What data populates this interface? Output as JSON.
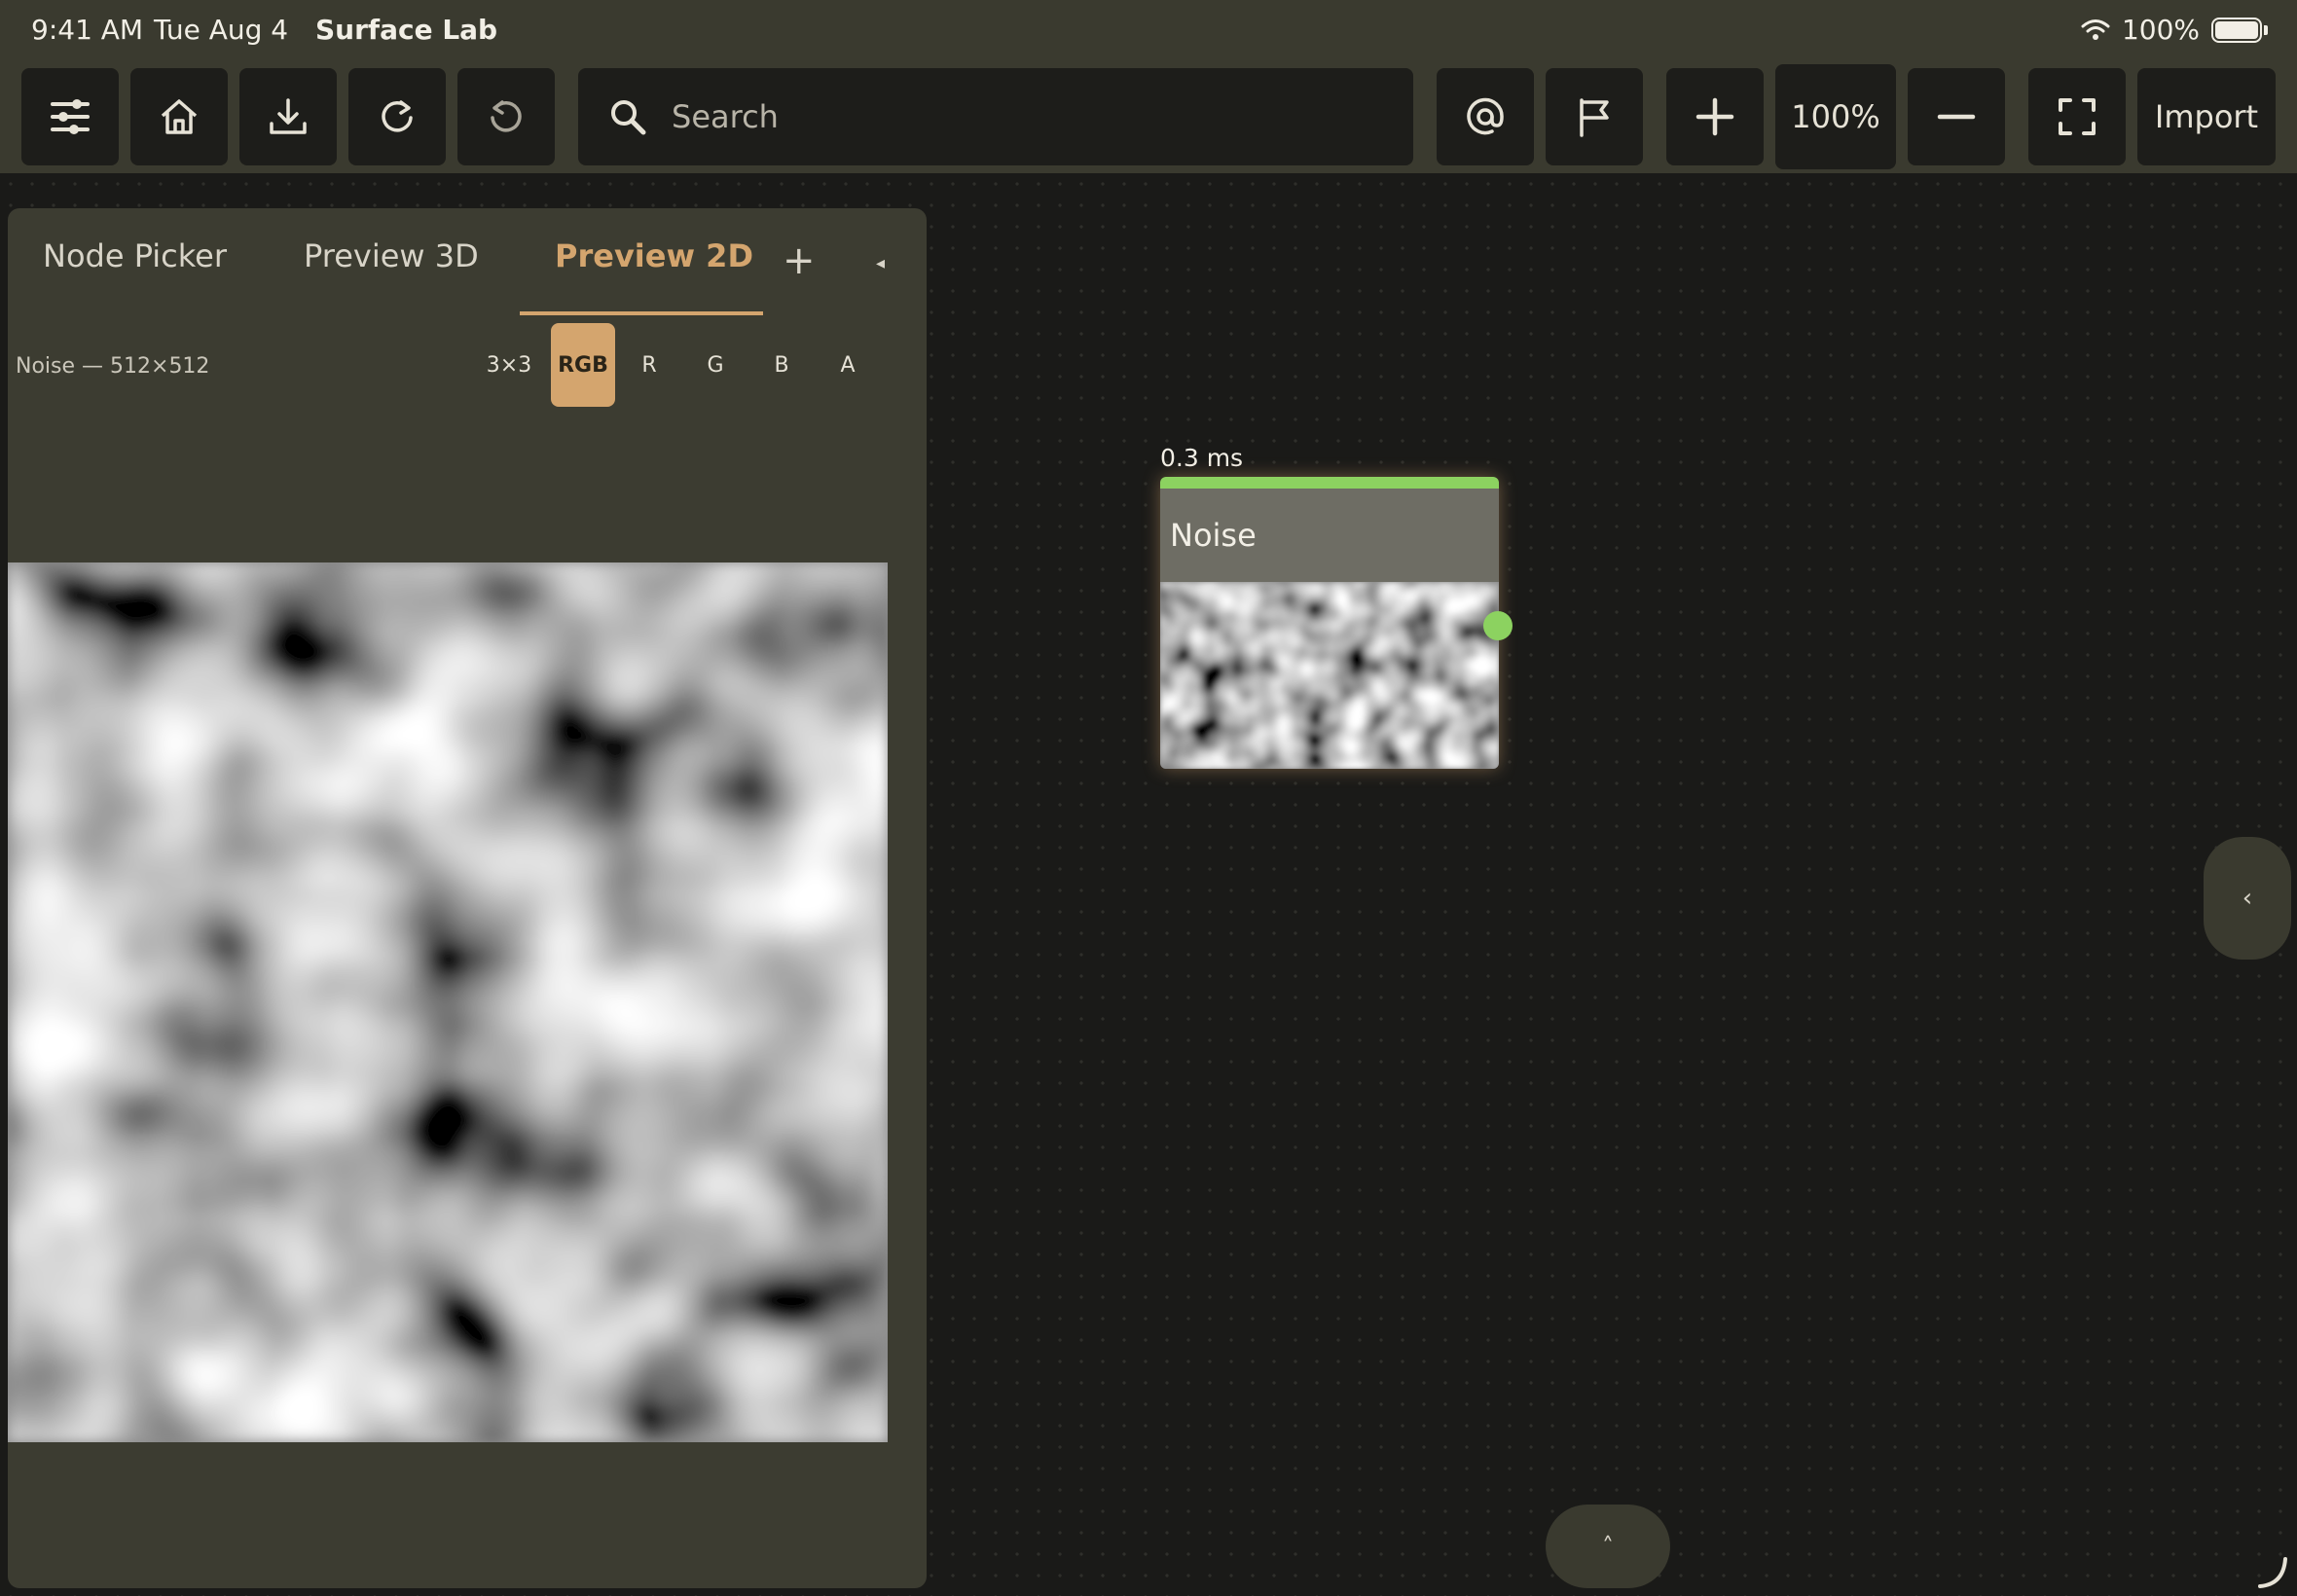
{
  "status_bar": {
    "time": "9:41 AM",
    "date": "Tue Aug 4",
    "app_name": "Surface Lab",
    "battery": "100%"
  },
  "toolbar": {
    "buttons": [
      {
        "icon": "sliders-icon"
      },
      {
        "icon": "home-icon"
      },
      {
        "icon": "download-icon"
      },
      {
        "icon": "redo-icon"
      },
      {
        "icon": "undo-icon"
      }
    ],
    "search_placeholder": "Search",
    "right_buttons": [
      {
        "icon": "at-sign-icon"
      },
      {
        "icon": "flag-icon"
      },
      {
        "icon": "zoom-in-icon"
      },
      {
        "icon": "zoom-out-icon"
      },
      {
        "icon": "fullscreen-icon"
      }
    ],
    "zoom_level": "100%",
    "import_label": "Import"
  },
  "panel": {
    "tabs": [
      {
        "label": "Node Picker",
        "active": false
      },
      {
        "label": "Preview 3D",
        "active": false
      },
      {
        "label": "Preview 2D",
        "active": true
      }
    ],
    "add_tab": "+",
    "collapse": "◂",
    "preview_label": "Noise — 512×512",
    "channels": [
      {
        "label": "3×3",
        "active": false
      },
      {
        "label": "RGB",
        "active": true
      },
      {
        "label": "R",
        "active": false
      },
      {
        "label": "G",
        "active": false
      },
      {
        "label": "B",
        "active": false
      },
      {
        "label": "A",
        "active": false
      }
    ]
  },
  "node": {
    "time": "0.3 ms",
    "title": "Noise",
    "accent": "#8cd260"
  },
  "handles": {
    "side": "‹",
    "bottom": "˄"
  },
  "colors": {
    "accent": "#d4a56e",
    "panel": "#3c3c31",
    "toolbar": "#3a3a2f",
    "canvas": "#1a1a18",
    "port": "#8cd260"
  }
}
